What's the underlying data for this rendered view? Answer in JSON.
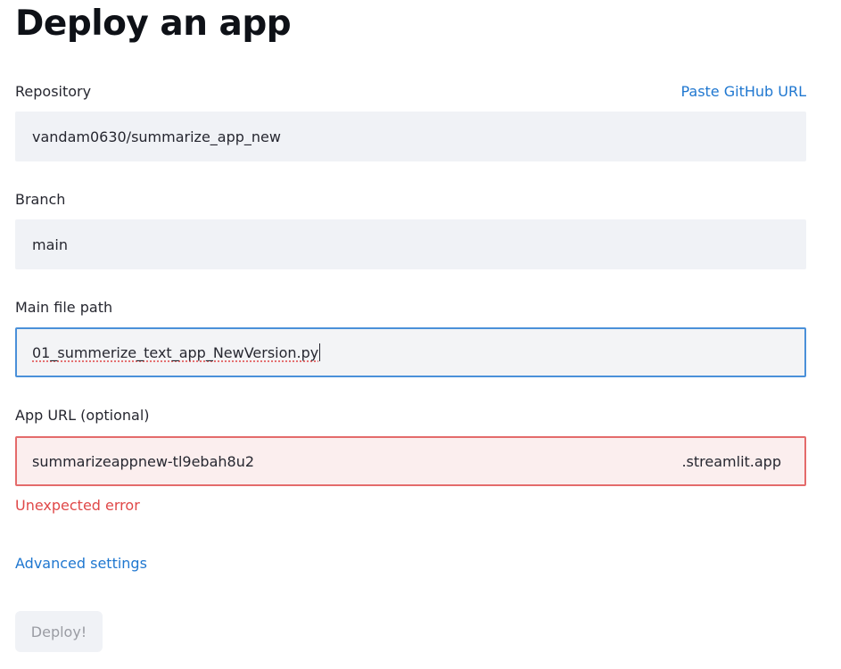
{
  "page": {
    "title": "Deploy an app"
  },
  "repository": {
    "label": "Repository",
    "paste_link": "Paste GitHub URL",
    "value": "vandam0630/summarize_app_new"
  },
  "branch": {
    "label": "Branch",
    "value": "main"
  },
  "main_file": {
    "label": "Main file path",
    "value": "01_summerize_text_app_NewVersion.py"
  },
  "app_url": {
    "label": "App URL (optional)",
    "value": "summarizeappnew-tl9ebah8u2",
    "suffix": ".streamlit.app",
    "error": "Unexpected error"
  },
  "advanced": {
    "label": "Advanced settings"
  },
  "deploy": {
    "label": "Deploy!"
  },
  "colors": {
    "link": "#1f77d0",
    "error": "#e04848",
    "focus_border": "#4a90d9",
    "input_bg": "#f0f2f6"
  }
}
